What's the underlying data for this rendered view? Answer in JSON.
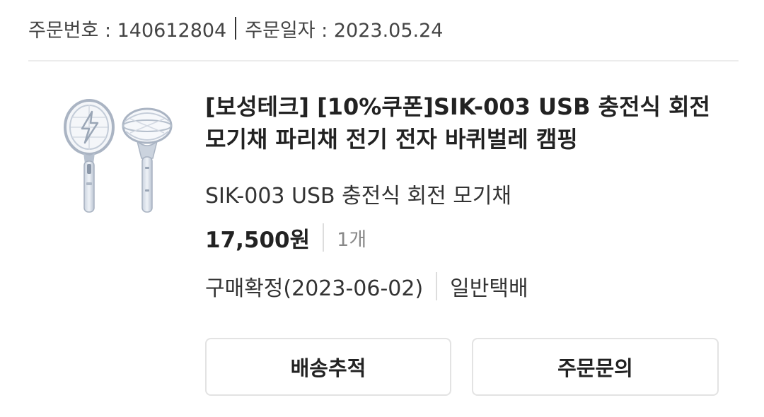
{
  "order": {
    "number_text": "주문번호 : 140612804",
    "date_text": "주문일자 : 2023.05.24"
  },
  "product": {
    "image_icon": "mosquito-racket-image",
    "title": "[보성테크] [10%쿠폰]SIK-003 USB 충전식 회전 모기채 파리채 전기 전자 바퀴벌레 캠핑",
    "option": "SIK-003 USB 충전식 회전 모기채",
    "price": "17,500원",
    "quantity": "1개",
    "status": "구매확정(2023-06-02)",
    "delivery_type": "일반택배"
  },
  "actions": {
    "track_label": "배송추적",
    "inquiry_label": "주문문의"
  }
}
